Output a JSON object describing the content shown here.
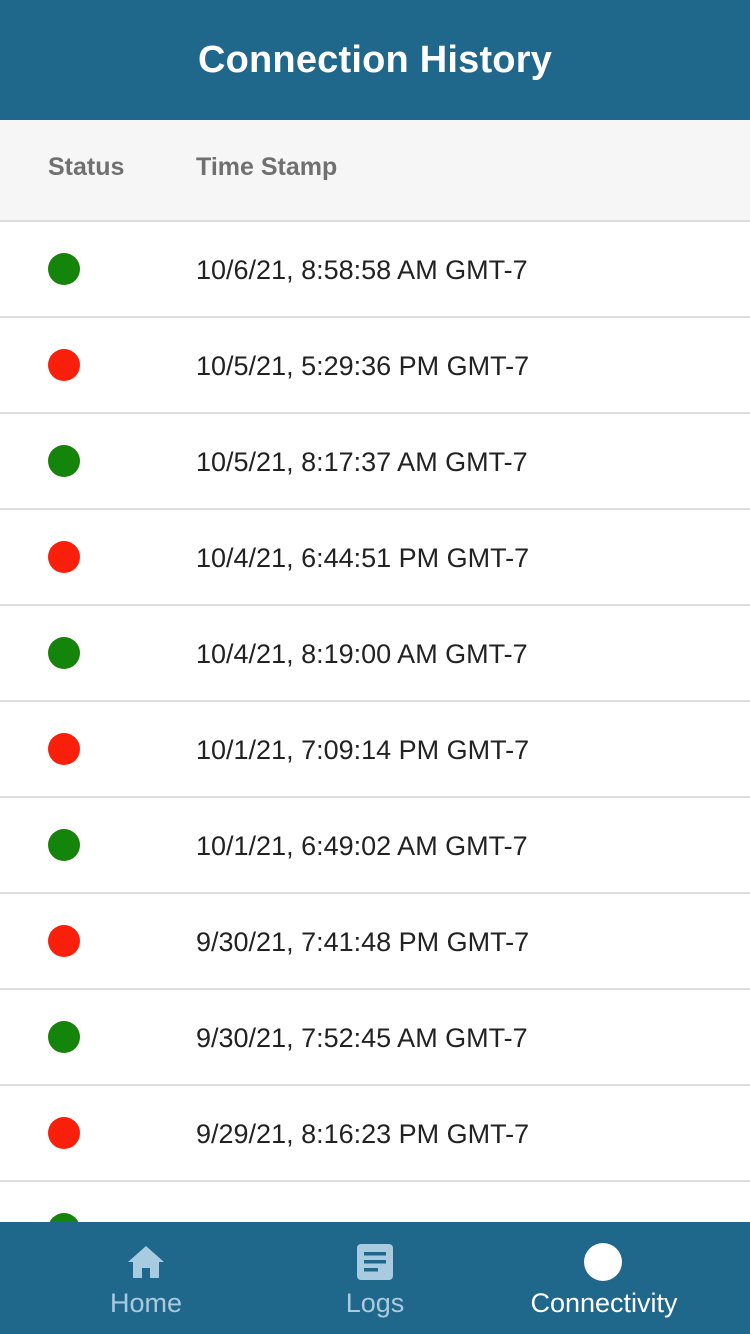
{
  "header": {
    "title": "Connection History"
  },
  "columns": {
    "status": "Status",
    "timestamp": "Time Stamp"
  },
  "status_colors": {
    "connected": "#15840a",
    "disconnected": "#fa1f0b"
  },
  "rows": [
    {
      "status": "connected",
      "timestamp": "10/6/21, 8:58:58 AM GMT-7"
    },
    {
      "status": "disconnected",
      "timestamp": "10/5/21, 5:29:36 PM GMT-7"
    },
    {
      "status": "connected",
      "timestamp": "10/5/21, 8:17:37 AM GMT-7"
    },
    {
      "status": "disconnected",
      "timestamp": "10/4/21, 6:44:51 PM GMT-7"
    },
    {
      "status": "connected",
      "timestamp": "10/4/21, 8:19:00 AM GMT-7"
    },
    {
      "status": "disconnected",
      "timestamp": "10/1/21, 7:09:14 PM GMT-7"
    },
    {
      "status": "connected",
      "timestamp": "10/1/21, 6:49:02 AM GMT-7"
    },
    {
      "status": "disconnected",
      "timestamp": "9/30/21, 7:41:48 PM GMT-7"
    },
    {
      "status": "connected",
      "timestamp": "9/30/21, 7:52:45 AM GMT-7"
    },
    {
      "status": "disconnected",
      "timestamp": "9/29/21, 8:16:23 PM GMT-7"
    },
    {
      "status": "connected",
      "timestamp": ""
    }
  ],
  "tabs": [
    {
      "label": "Home",
      "icon": "home-icon",
      "active": false
    },
    {
      "label": "Logs",
      "icon": "logs-icon",
      "active": false
    },
    {
      "label": "Connectivity",
      "icon": "connectivity-icon",
      "active": true
    }
  ]
}
